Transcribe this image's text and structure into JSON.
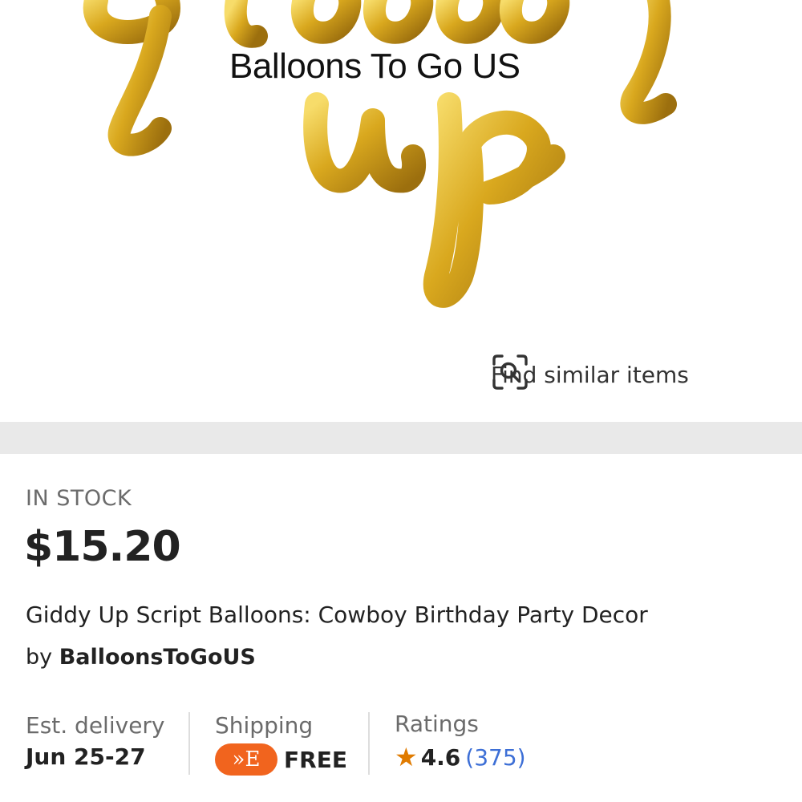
{
  "hero": {
    "watermark": "Balloons To Go US"
  },
  "find_similar": {
    "label": "Find similar items",
    "icon": "visual-search-icon"
  },
  "listing": {
    "stock_status": "IN STOCK",
    "price": "$15.20",
    "title": "Giddy Up Script Balloons: Cowboy Birthday Party Decor",
    "by_prefix": "by",
    "shop_name": "BalloonsToGoUS"
  },
  "stats": {
    "delivery": {
      "label": "Est. delivery",
      "value": "Jun 25-27"
    },
    "shipping": {
      "label": "Shipping",
      "badge": "»E",
      "value": "FREE"
    },
    "ratings": {
      "label": "Ratings",
      "score": "4.6",
      "count": "(375)"
    }
  },
  "colors": {
    "accent": "#f1641e",
    "link": "#3d6fd6",
    "star": "#e07b00",
    "balloon_gold": "#d9a81e"
  }
}
